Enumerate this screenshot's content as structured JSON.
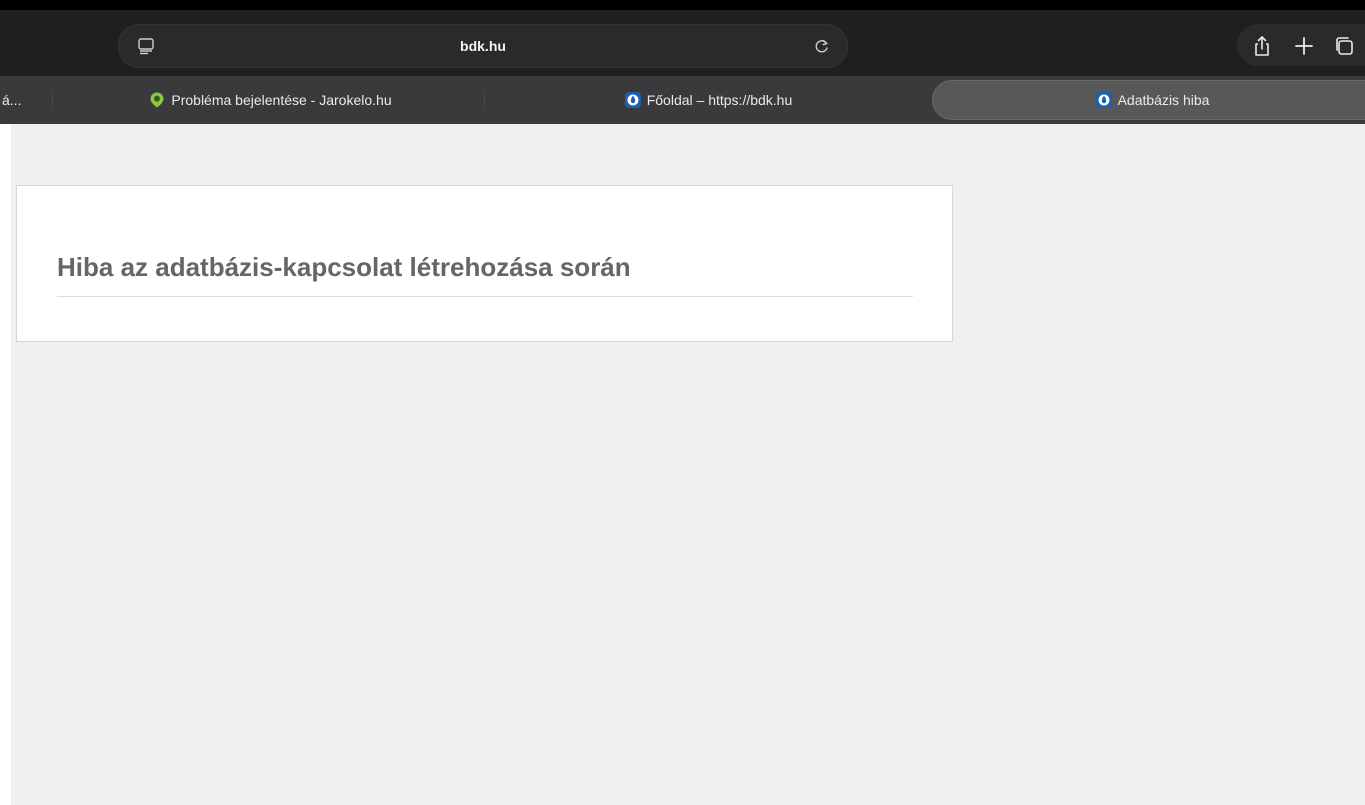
{
  "browser": {
    "address": "bdk.hu",
    "tabs": [
      {
        "title": "á...",
        "icon": "truncated-tab"
      },
      {
        "title": "Probléma bejelentése - Jarokelo.hu",
        "icon": "jarokelo-favicon"
      },
      {
        "title": "Főoldal – https://bdk.hu",
        "icon": "bdk-favicon"
      },
      {
        "title": "Adatbázis hiba",
        "icon": "bdk-favicon",
        "active": true
      }
    ],
    "actions": [
      "share-icon",
      "new-tab-icon",
      "tab-overview-icon"
    ]
  },
  "page": {
    "error_title": "Hiba az adatbázis-kapcsolat létrehozása során"
  },
  "colors": {
    "page_background": "#f0f0f0",
    "card_background": "#ffffff",
    "title_text": "#666666",
    "toolbar": "#2c2c2e",
    "tabstrip": "#3a3a3c"
  }
}
